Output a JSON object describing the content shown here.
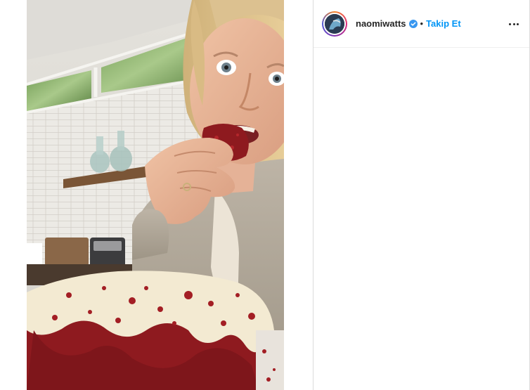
{
  "post": {
    "username": "naomiwatts",
    "verified": true,
    "separator": "•",
    "follow_label": "Takip Et"
  },
  "icons": {
    "verified": "verified-badge-icon",
    "more": "more-options-icon"
  },
  "colors": {
    "follow_blue": "#0095f6",
    "verified_blue": "#3897f0",
    "cake_red": "#8e1a1f",
    "frosting": "#f3ead2"
  }
}
